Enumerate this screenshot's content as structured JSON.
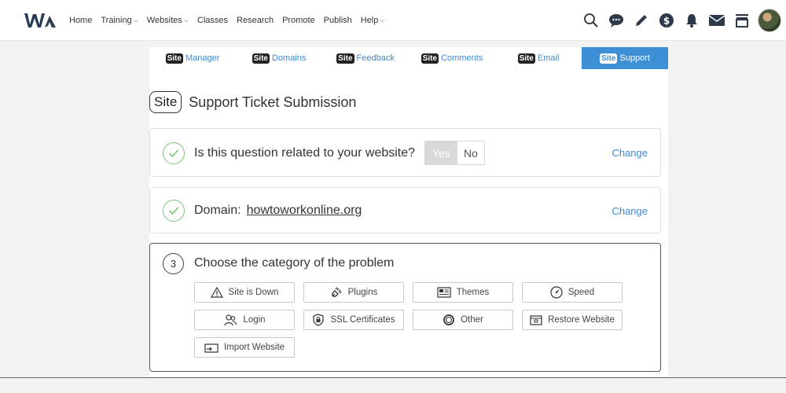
{
  "nav": {
    "links": [
      {
        "label": "Home",
        "dropdown": false
      },
      {
        "label": "Training",
        "dropdown": true
      },
      {
        "label": "Websites",
        "dropdown": true
      },
      {
        "label": "Classes",
        "dropdown": false
      },
      {
        "label": "Research",
        "dropdown": false
      },
      {
        "label": "Promote",
        "dropdown": false
      },
      {
        "label": "Publish",
        "dropdown": false
      },
      {
        "label": "Help",
        "dropdown": true
      }
    ],
    "icons": [
      "search-icon",
      "chat-icon",
      "pencil-icon",
      "dollar-icon",
      "bell-icon",
      "mail-icon",
      "inbox-icon"
    ]
  },
  "tabs": [
    {
      "badge": "Site",
      "label": "Manager",
      "active": false
    },
    {
      "badge": "Site",
      "label": "Domains",
      "active": false
    },
    {
      "badge": "Site",
      "label": "Feedback",
      "active": false
    },
    {
      "badge": "Site",
      "label": "Comments",
      "active": false
    },
    {
      "badge": "Site",
      "label": "Email",
      "active": false
    },
    {
      "badge": "Site",
      "label": "Support",
      "active": true
    }
  ],
  "page": {
    "badge": "Site",
    "title": "Support Ticket Submission"
  },
  "step1": {
    "question": "Is this question related to your website?",
    "yes_label": "Yes",
    "no_label": "No",
    "change_label": "Change"
  },
  "step2": {
    "label": "Domain:",
    "domain": "howtoworkonline.org",
    "change_label": "Change"
  },
  "step3": {
    "number": "3",
    "title": "Choose the category of the problem",
    "categories": [
      {
        "label": "Site is Down",
        "icon": "warning-icon"
      },
      {
        "label": "Plugins",
        "icon": "plug-icon"
      },
      {
        "label": "Themes",
        "icon": "theme-icon"
      },
      {
        "label": "Speed",
        "icon": "speedometer-icon"
      },
      {
        "label": "Login",
        "icon": "users-icon"
      },
      {
        "label": "SSL Certificates",
        "icon": "shield-icon"
      },
      {
        "label": "Other",
        "icon": "circle-icon"
      },
      {
        "label": "Restore Website",
        "icon": "restore-icon"
      },
      {
        "label": "Import Website",
        "icon": "import-icon"
      }
    ]
  },
  "colors": {
    "accent": "#3d8fd6",
    "link": "#3c8ad8",
    "check": "#7cc47c"
  }
}
